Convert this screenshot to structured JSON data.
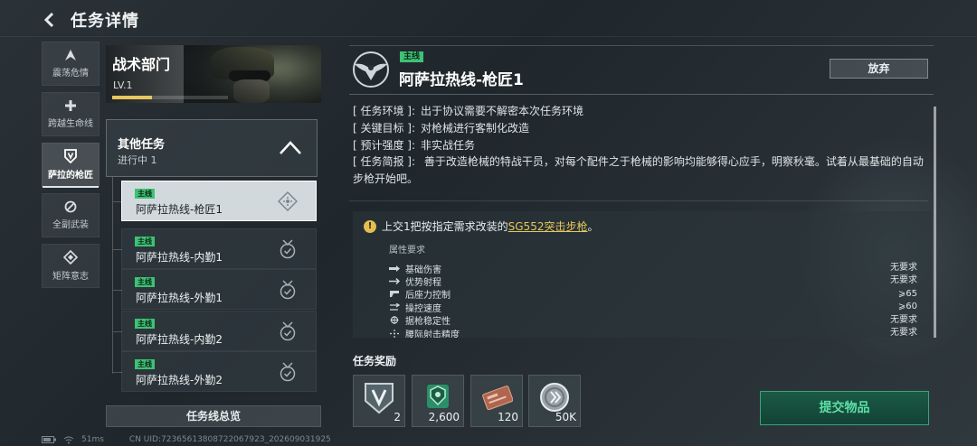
{
  "header": {
    "title": "任务详情"
  },
  "nav": [
    {
      "label": "震荡危情",
      "icon": "a-mark-icon"
    },
    {
      "label": "跨越生命线",
      "icon": "cross-icon"
    },
    {
      "label": "萨拉的枪匠",
      "icon": "shield-v-icon",
      "active": true
    },
    {
      "label": "全副武装",
      "icon": "slash-circle-icon"
    },
    {
      "label": "矩阵意志",
      "icon": "diamond-arrows-icon"
    }
  ],
  "faction": {
    "name": "战术部门",
    "level": "LV.1",
    "xp_progress": 0.34
  },
  "group": {
    "title": "其他任务",
    "status": "进行中 1"
  },
  "quests": [
    {
      "tag": "主线",
      "name": "阿萨拉热线-枪匠1",
      "active": true,
      "icon": "target-icon"
    },
    {
      "tag": "主线",
      "name": "阿萨拉热线-内勤1",
      "icon": "medal-check-icon"
    },
    {
      "tag": "主线",
      "name": "阿萨拉热线-外勤1",
      "icon": "medal-check-icon"
    },
    {
      "tag": "主线",
      "name": "阿萨拉热线-内勤2",
      "icon": "medal-check-icon"
    },
    {
      "tag": "主线",
      "name": "阿萨拉热线-外勤2",
      "icon": "medal-check-icon"
    }
  ],
  "overview_label": "任务线总览",
  "detail": {
    "tag": "主线",
    "title": "阿萨拉热线-枪匠1",
    "abandon_label": "放弃",
    "info": [
      {
        "key": "[ 任务环境 ]:",
        "value": "出于协议需要不解密本次任务环境"
      },
      {
        "key": "[ 关键目标 ]:",
        "value": "对枪械进行客制化改造"
      },
      {
        "key": "[ 预计强度 ]:",
        "value": "非实战任务"
      }
    ],
    "brief_key": "[ 任务简报 ]:",
    "brief_value": "善于改造枪械的特战干员，对每个配件之于枪械的影响均能够得心应手，明察秋毫。试着从最基础的自动步枪开始吧。",
    "requirement": {
      "prefix": "上交1把按指定需求改装的",
      "link": "SG552突击步枪",
      "suffix": "。",
      "attr_title": "属性要求",
      "attrs": [
        {
          "name": "基础伤害",
          "value": "无要求"
        },
        {
          "name": "优势射程",
          "value": "无要求"
        },
        {
          "name": "后座力控制",
          "value": "⩾65"
        },
        {
          "name": "操控速度",
          "value": "⩾60"
        },
        {
          "name": "据枪稳定性",
          "value": "无要求"
        },
        {
          "name": "腰际射击精度",
          "value": "无要求"
        }
      ]
    }
  },
  "rewards": {
    "title": "任务奖励",
    "items": [
      {
        "icon": "shield-v-icon",
        "qty": "2"
      },
      {
        "icon": "army-badge-icon",
        "qty": "2,600"
      },
      {
        "icon": "card-icon",
        "qty": "120"
      },
      {
        "icon": "coin-icon",
        "qty": "50K"
      }
    ]
  },
  "submit_label": "提交物品",
  "status": {
    "ping": "51ms",
    "uid": "CN UID:7236561380872206792З_202609031925"
  },
  "colors": {
    "accent_green": "#3ec276",
    "link_gold": "#e6c85a",
    "submit_text": "#5de0a6"
  }
}
